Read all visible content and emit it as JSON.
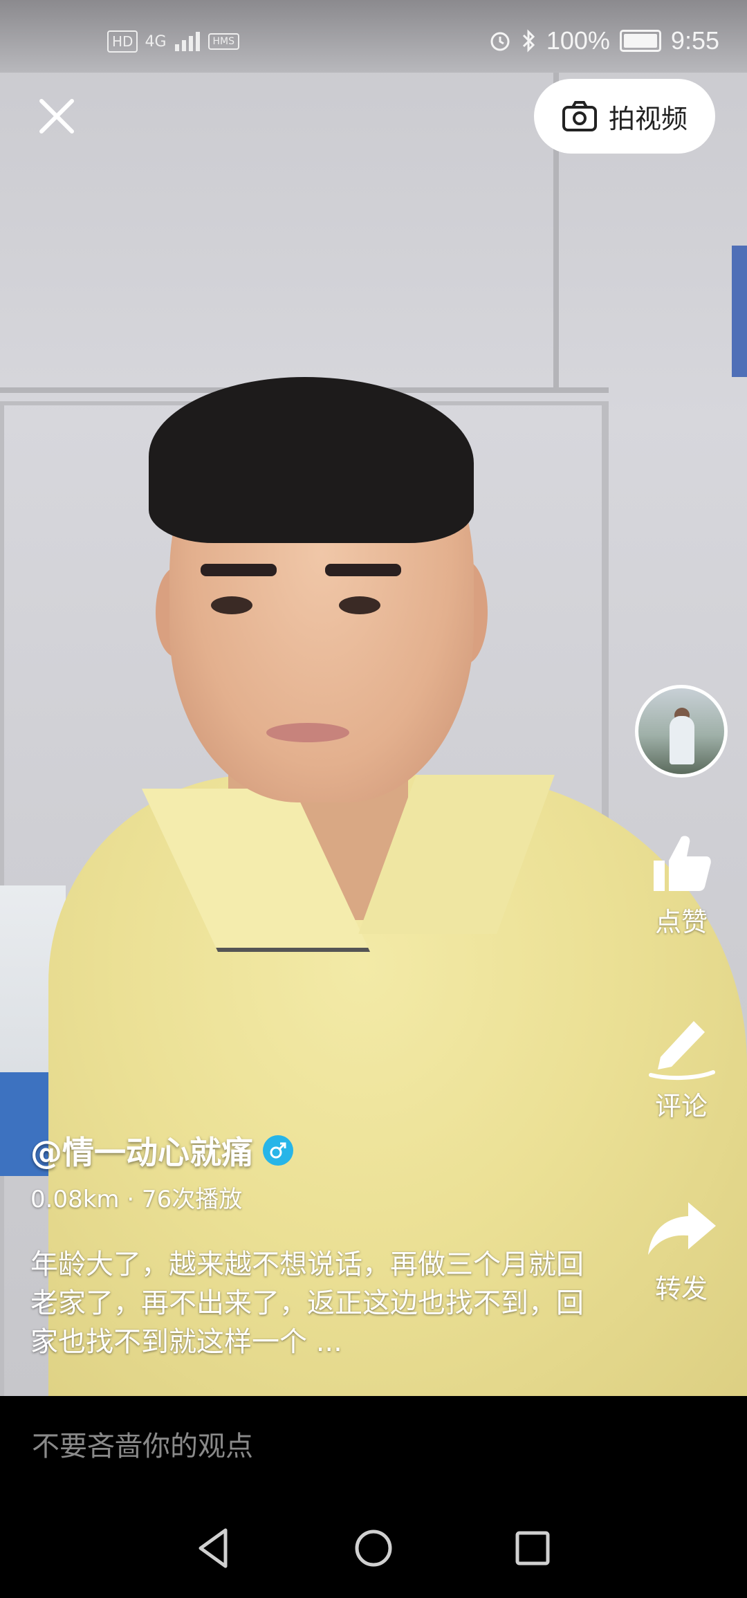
{
  "status_bar": {
    "hd": "HD",
    "network": "4G",
    "hms": "HMS",
    "battery": "100%",
    "time": "9:55"
  },
  "top": {
    "shoot_label": "拍视频"
  },
  "actions": {
    "like": "点赞",
    "comment": "评论",
    "share": "转发"
  },
  "post": {
    "username": "@情一动心就痛",
    "meta": "0.08km · 76次播放",
    "description": "年龄大了，越来越不想说话，再做三个月就回老家了，再不出来了，返正这边也找不到，回家也找不到就这样一个 ..."
  },
  "comment_bar": {
    "placeholder": "不要吝啬你的观点"
  },
  "colors": {
    "gender_badge": "#27b5e8",
    "background": "#000000"
  }
}
